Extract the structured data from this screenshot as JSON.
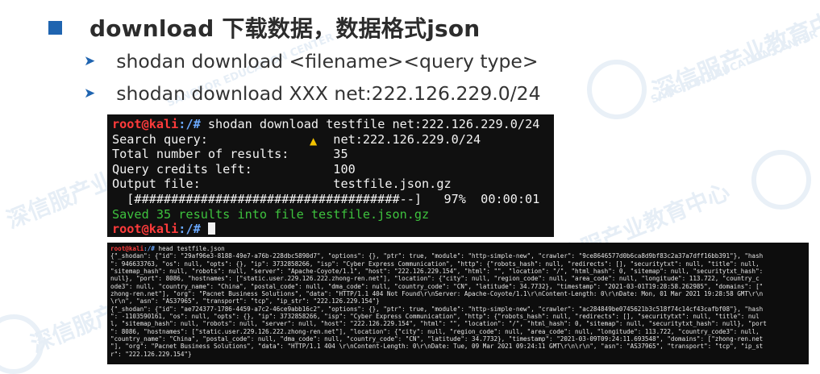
{
  "slide": {
    "title": "download 下载数据，数据格式json",
    "bullets": [
      "shodan download <filename><query type>",
      "shodan download XXX net:222.126.229.0/24"
    ],
    "watermark": {
      "cn": "深信服产业教育中心",
      "en": "SANGFOR EDUCATION CENTER"
    }
  },
  "terminal1": {
    "prompt_user": "root@kali",
    "prompt_path": ":/#",
    "command": "shodan download testfile net:222.126.229.0/24",
    "rows": [
      "Search query:                 net:222.126.229.0/24",
      "Total number of results:      35",
      "Query credits left:           100",
      "Output file:                  testfile.json.gz",
      "  [####################################--]   97%  00:00:01"
    ],
    "saved": "Saved 35 results into file testfile.json.gz",
    "prompt2_user": "root@kali",
    "prompt2_path": ":/#"
  },
  "terminal2": {
    "prompt_user": "root@kali",
    "prompt_path": ":/#",
    "command": "head testfile.json",
    "lines": [
      "{\"_shodan\": {\"id\": \"29af96e3-8188-49e7-a76b-228dbc5890d7\", \"options\": {}, \"ptr\": true, \"module\": \"http-simple-new\", \"crawler\": \"9ce8646577d0b6ca8d9bf83c2a37a7dff16bb391\"}, \"hash",
      "\": 946633763, \"os\": null, \"opts\": {}, \"ip\": 3732858266, \"isp\": \"Cyber Express Communication\", \"http\": {\"robots_hash\": null, \"redirects\": [], \"securitytxt\": null, \"title\": null,",
      "\"sitemap_hash\": null, \"robots\": null, \"server\": \"Apache-Coyote/1.1\", \"host\": \"222.126.229.154\", \"html\": \"\", \"location\": \"/\", \"html_hash\": 0, \"sitemap\": null, \"securitytxt_hash\":",
      "null}, \"port\": 8086, \"hostnames\": [\"static.user.229.126.222.zhong-ren.net\"], \"location\": {\"city\": null, \"region_code\": null, \"area_code\": null, \"longitude\": 113.722, \"country_c",
      "ode3\": null, \"country_name\": \"China\", \"postal_code\": null, \"dma_code\": null, \"country_code\": \"CN\", \"latitude\": 34.7732}, \"timestamp\": \"2021-03-01T19:28:58.262985\", \"domains\": [\"",
      "zhong-ren.net\"], \"org\": \"Pacnet Business Solutions\", \"data\": \"HTTP/1.1 404 Not Found\\r\\nServer: Apache-Coyote/1.1\\r\\nContent-Length: 0\\r\\nDate: Mon, 01 Mar 2021 19:28:58 GMT\\r\\n",
      "\\r\\n\", \"asn\": \"AS37965\", \"transport\": \"tcp\", \"ip_str\": \"222.126.229.154\"}",
      "{\"_shodan\": {\"id\": \"ae724377-1786-4459-a7c2-46ce9abb16c2\", \"options\": {}, \"ptr\": true, \"module\": \"http-simple-new\", \"crawler\": \"ac284849be0745621b3c518f74c14cf43cafbf08\"}, \"hash",
      "\": -1103590161, \"os\": null, \"opts\": {}, \"ip\": 3732858266, \"isp\": \"Cyber Express Communication\", \"http\": {\"robots_hash\": null, \"redirects\": [], \"securitytxt\": null, \"title\": nul",
      "l, \"sitemap_hash\": null, \"robots\": null, \"server\": null, \"host\": \"222.126.229.154\", \"html\": \"\", \"location\": \"/\", \"html_hash\": 0, \"sitemap\": null, \"securitytxt_hash\": null}, \"port",
      "\": 8086, \"hostnames\": [\"static.user.229.126.222.zhong-ren.net\"], \"location\": {\"city\": null, \"region_code\": null, \"area_code\": null, \"longitude\": 113.722, \"country_code3\": null,",
      "\"country_name\": \"China\", \"postal_code\": null, \"dma_code\": null, \"country_code\": \"CN\", \"latitude\": 34.7732}, \"timestamp\": \"2021-03-09T09:24:11.693548\", \"domains\": [\"zhong-ren.net",
      "\"], \"org\": \"Pacnet Business Solutions\", \"data\": \"HTTP/1.1 404 \\r\\nContent-Length: 0\\r\\nDate: Tue, 09 Mar 2021 09:24:11 GMT\\r\\n\\r\\n\", \"asn\": \"AS37965\", \"transport\": \"tcp\", \"ip_st",
      "r\": \"222.126.229.154\"}"
    ]
  },
  "colors": {
    "bullet_square": "#1f64b0",
    "terminal_bg": "#101010",
    "prompt_red": "#ff3b3b",
    "prompt_blue": "#6aa9ff",
    "saved_green": "#3ec23e"
  }
}
